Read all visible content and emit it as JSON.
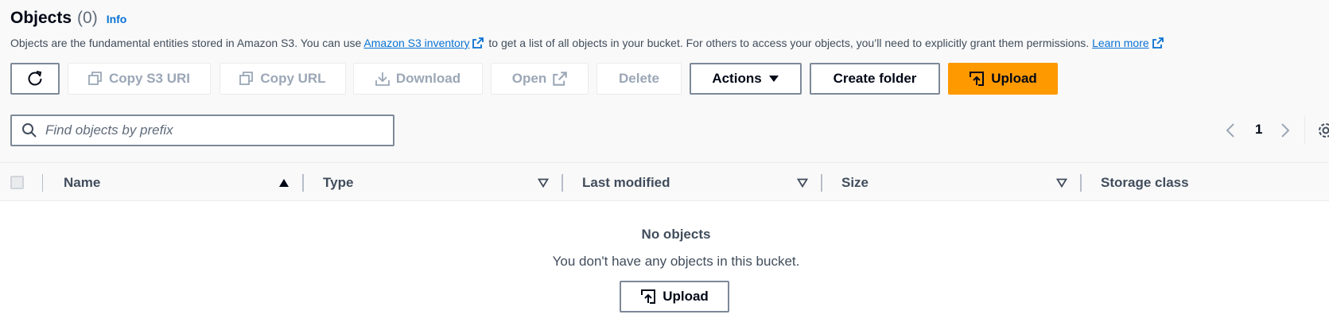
{
  "header": {
    "title": "Objects",
    "count": "(0)",
    "info": "Info"
  },
  "description": {
    "part1": "Objects are the fundamental entities stored in Amazon S3. You can use ",
    "inventory_link": "Amazon S3 inventory",
    "part2": " to get a list of all objects in your bucket. For others to access your objects, you’ll need to explicitly grant them permissions. ",
    "learn_more": "Learn more"
  },
  "toolbar": {
    "refresh_icon": "refresh-icon",
    "copy_s3_uri": "Copy S3 URI",
    "copy_url": "Copy URL",
    "download": "Download",
    "open": "Open",
    "delete": "Delete",
    "actions": "Actions",
    "create_folder": "Create folder",
    "upload": "Upload"
  },
  "search": {
    "placeholder": "Find objects by prefix"
  },
  "pagination": {
    "current_page": "1"
  },
  "table": {
    "columns": [
      "Name",
      "Type",
      "Last modified",
      "Size",
      "Storage class"
    ]
  },
  "empty_state": {
    "title": "No objects",
    "message": "You don't have any objects in this bucket.",
    "upload": "Upload"
  },
  "colors": {
    "primary": "#ff9900",
    "link": "#0972d3",
    "disabled": "#9ba7b6"
  }
}
